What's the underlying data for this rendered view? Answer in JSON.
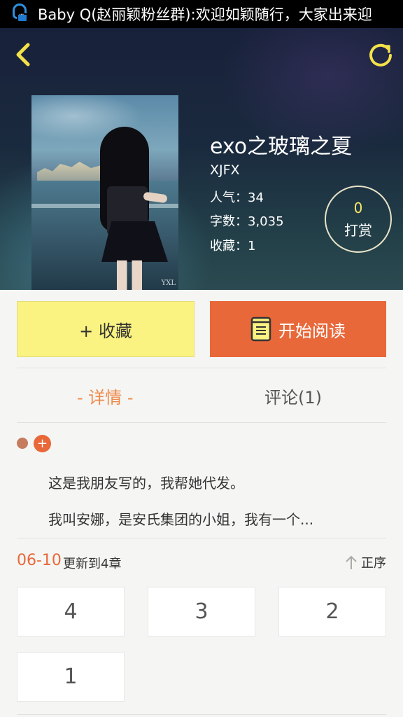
{
  "statusbar": {
    "notification": "Baby Q(赵丽颖粉丝群):欢迎如颖随行，大家出来迎"
  },
  "book": {
    "title": "exo之玻璃之夏",
    "author": "XJFX",
    "popularity_label": "人气：",
    "popularity": "34",
    "words_label": "字数：",
    "words": "3,035",
    "favorites_label": "收藏：",
    "favorites": "1",
    "cover_watermark": "YXL"
  },
  "tip": {
    "count": "0",
    "label": "打赏"
  },
  "actions": {
    "collect_label": "+ 收藏",
    "read_label": "开始阅读"
  },
  "tabs": {
    "detail": "- 详情 -",
    "comments": "评论(1)"
  },
  "intro": {
    "line1": "这是我朋友写的，我帮她代发。",
    "line2": "我叫安娜，是安氏集团的小姐，我有一个..."
  },
  "update": {
    "date": "06-10",
    "text": "更新到4章",
    "sort_label": "正序"
  },
  "chapters": [
    "4",
    "3",
    "2",
    "1"
  ],
  "colors": {
    "accent": "#e8683a",
    "collect_yellow": "#fbf381",
    "tab_active": "#ee8a4b",
    "header_dark": "#1a2a3e"
  },
  "icons": [
    "qq-icon",
    "back-icon",
    "refresh-icon",
    "book-icon",
    "sort-up-icon",
    "add-icon"
  ]
}
